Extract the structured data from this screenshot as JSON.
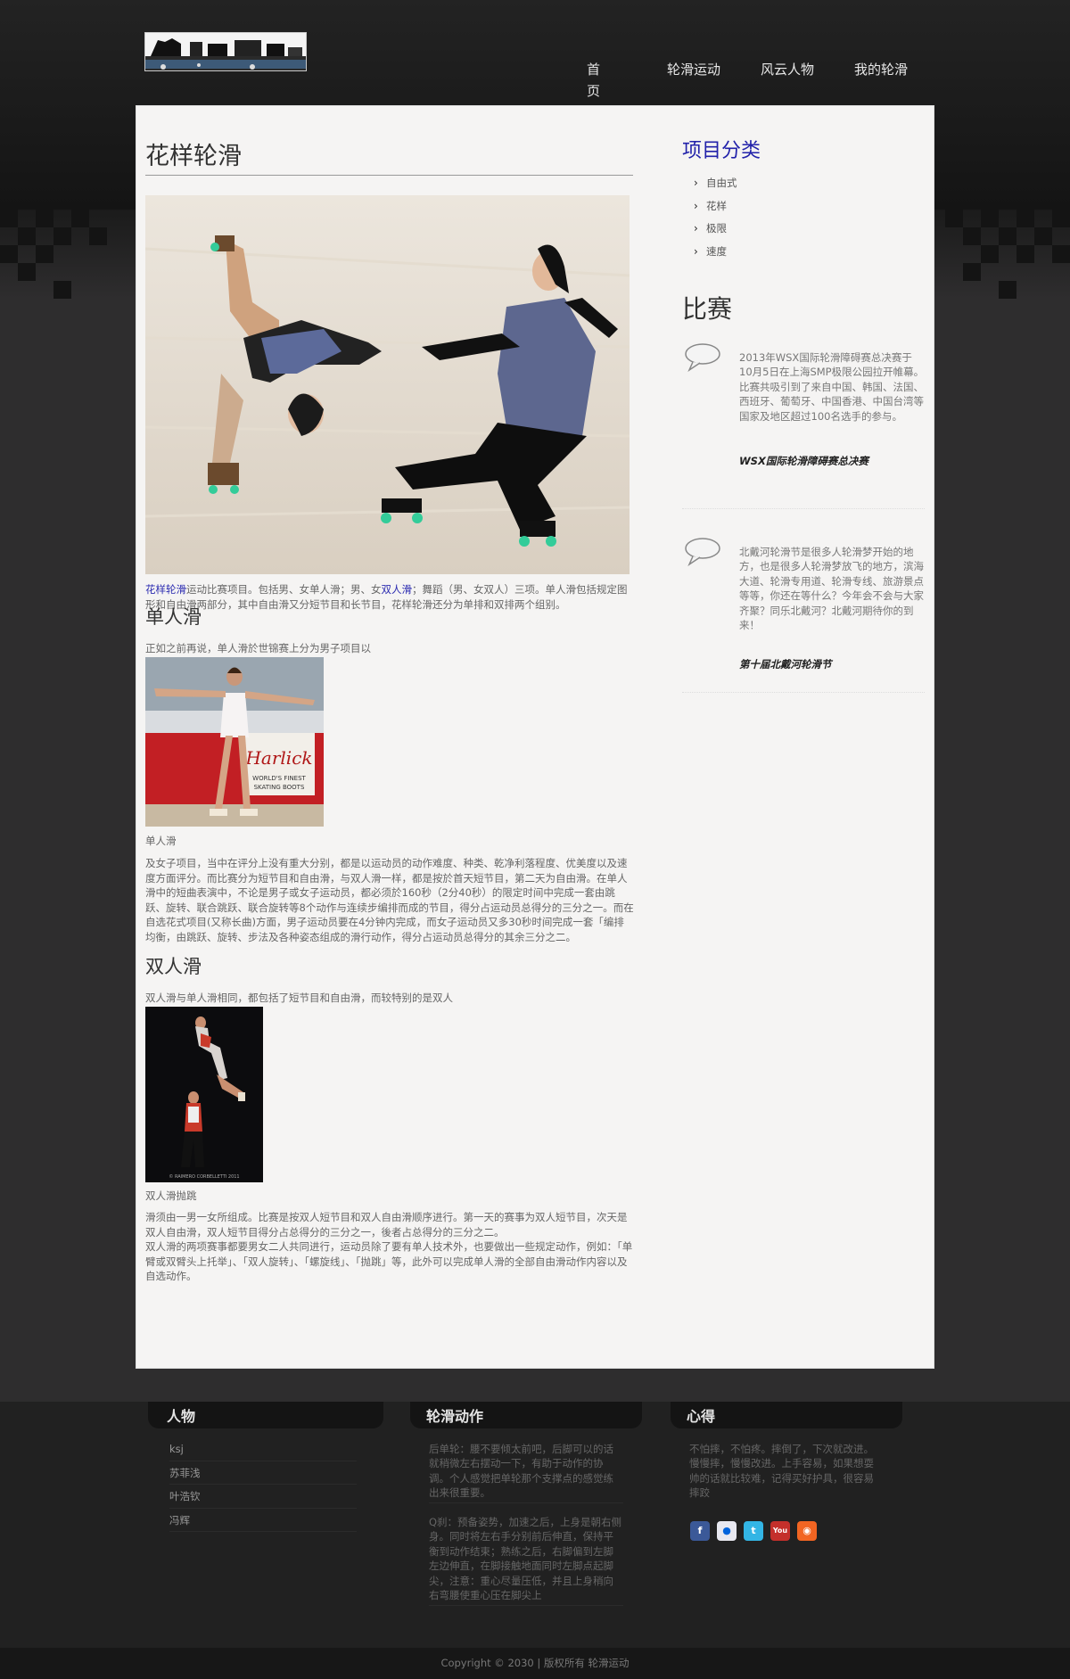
{
  "nav": {
    "items": [
      "首页",
      "轮滑运动",
      "风云人物",
      "我的轮滑"
    ]
  },
  "main": {
    "title": "花样轮滑",
    "intro_link1": "花样轮滑",
    "intro_mid": "运动比赛项目。包括男、女单人滑；男、女",
    "intro_link2": "双人滑",
    "intro_rest": "；舞蹈（男、女双人）三项。单人滑包括规定图形和自由滑两部分，其中自由滑又分短节目和长节目，花样轮滑还分为单排和双排两个组别。",
    "single": {
      "heading": "单人滑",
      "lead": "正如之前再说，单人滑於世锦赛上分为男子项目以",
      "caption": "单人滑",
      "body": "及女子项目，当中在评分上没有重大分别，都是以运动员的动作难度、种类、乾净利落程度、优美度以及速度方面评分。而比赛分为短节目和自由滑，与双人滑一样，都是按於首天短节目，第二天为自由滑。在单人滑中的短曲表演中，不论是男子或女子运动员，都必须於160秒（2分40秒）的限定时间中完成一套由跳跃、旋转、联合跳跃、联合旋转等8个动作与连续步编排而成的节目，得分占运动员总得分的三分之一。而在自选花式项目(又称长曲)方面，男子运动员要在4分钟内完成，而女子运动员又多30秒时间完成一套「编排均衡，由跳跃、旋转、步法及各种姿态组成的滑行动作，得分占运动员总得分的其余三分之二。"
    },
    "pair": {
      "heading": "双人滑",
      "lead": "双人滑与单人滑相同，都包括了短节目和自由滑，而较特别的是双人",
      "caption": "双人滑抛跳",
      "body1": "滑须由一男一女所组成。比赛是按双人短节目和双人自由滑顺序进行。第一天的赛事为双人短节目，次天是双人自由滑，双人短节目得分占总得分的三分之一，後者占总得分的三分之二。",
      "body2": "双人滑的两项赛事都要男女二人共同进行，运动员除了要有单人技术外，也要做出一些规定动作，例如：「单臂或双臂头上托举」、「双人旋转」、「螺旋线」、「抛跳」等，此外可以完成单人滑的全部自由滑动作内容以及自选动作。"
    }
  },
  "sidebar": {
    "category_title": "项目分类",
    "categories": [
      "自由式",
      "花样",
      "极限",
      "速度"
    ],
    "match_title": "比赛",
    "events": [
      {
        "text": "2013年WSX国际轮滑障碍赛总决赛于10月5日在上海SMP极限公园拉开帷幕。比赛共吸引到了来自中国、韩国、法国、西班牙、葡萄牙、中国香港、中国台湾等国家及地区超过100名选手的参与。",
        "name": "WSX国际轮滑障碍赛总决赛"
      },
      {
        "text": "北戴河轮滑节是很多人轮滑梦开始的地方，也是很多人轮滑梦放飞的地方，滨海大道、轮滑专用道、轮滑专线、旅游景点等等，你还在等什么？今年会不会与大家齐聚？同乐北戴河？北戴河期待你的到来！",
        "name": "第十届北戴河轮滑节"
      }
    ]
  },
  "footer": {
    "people_title": "人物",
    "people": [
      "ksj",
      "苏菲浅",
      "叶浩钦",
      "冯辉"
    ],
    "moves_title": "轮滑动作",
    "moves": [
      "后单轮：腰不要倾太前吧，后脚可以的话就稍微左右摆动一下，有助于动作的协调。个人感觉把单轮那个支撑点的感觉练出来很重要。",
      "Q刹：预备姿势，加速之后，上身是朝右侧身。同时将左右手分别前后伸直，保持平衡到动作结束；熟练之后，右脚偏到左脚左边伸直，在脚接触地面同时左脚点起脚尖，注意：重心尽量压低，并且上身稍向右弯腰使重心压在脚尖上"
    ],
    "mind_title": "心得",
    "mind": "不怕摔，不怕疼。摔倒了，下次就改进。慢慢摔，慢慢改进。上手容易，如果想耍帅的话就比较难，记得买好护具，很容易摔跤",
    "social_icons": [
      "facebook-icon",
      "flickr-icon",
      "twitter-icon",
      "youtube-icon",
      "rss-icon"
    ],
    "copyright": "Copyright © 2030 | 版权所有 轮滑运动"
  }
}
